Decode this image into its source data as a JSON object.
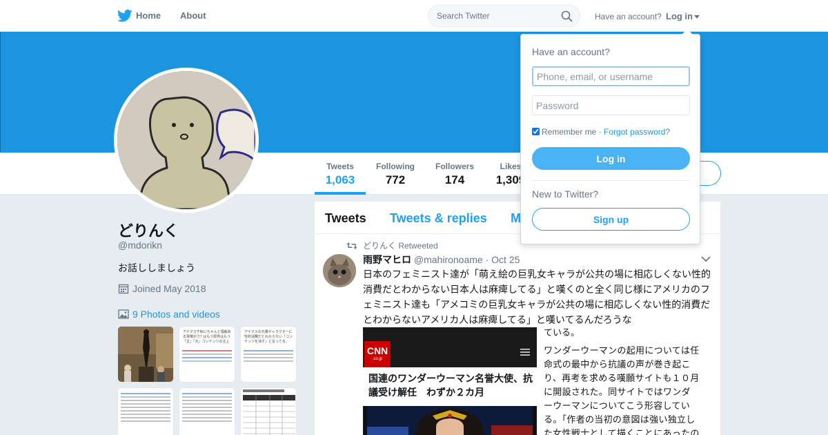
{
  "nav": {
    "home_label": "Home",
    "about_label": "About",
    "search_placeholder": "Search Twitter",
    "have_account": "Have an account?",
    "login_label": "Log in"
  },
  "colors": {
    "banner": "#1b95e0",
    "accent": "#1da1f2",
    "link": "#1b95e0"
  },
  "stats": [
    {
      "label": "Tweets",
      "value": "1,063",
      "active": true
    },
    {
      "label": "Following",
      "value": "772"
    },
    {
      "label": "Followers",
      "value": "174"
    },
    {
      "label": "Likes",
      "value": "1,309"
    }
  ],
  "profile": {
    "name": "どりんく",
    "handle": "@mdorikn",
    "bio": "お話ししましょう",
    "joined": "Joined May 2018",
    "photos_link": "9 Photos and videos"
  },
  "thumbnails": {
    "t2_text": "アイマス千秋にちゃんと理解ある現場がさ? はもう限界はもう「主」「元」コンテンツの主上",
    "t3_text": "アイマスの元量ギャラクターに性的消費だとわからない「コンテンツを消す」と言ってる。"
  },
  "timeline": {
    "tabs": [
      "Tweets",
      "Tweets & replies",
      "M"
    ],
    "retweet_line": "どりんく Retweeted",
    "tweet": {
      "fullname": "雨野マヒロ",
      "username": "@mahironoame",
      "date": "Oct 25",
      "text": "日本のフェミニスト達が「萌え絵の巨乳女キャラが公共の場に相応しくない性的消費だとわからない日本人は麻痺してる」と嘆くのと全く同じ様にアメリカのフェミニスト達も「アメコミの巨乳女キャラが公共の場に相応しくない性的消費だとわからないアメリカ人は麻痺してる」と嘆いてるんだろうな",
      "image": {
        "logo": "CNN",
        "logo_sub": ".co.jp",
        "headline": "国連のワンダーウーマン名誉大使、抗議受け解任　わずか２カ月"
      },
      "side_text_1": "ている。",
      "side_text_2": "ワンダーウーマンの起用については任命式の最中から抗議の声が巻き起こり、再考を求める嘆願サイトも１０月に開設された。同サイトではワンダーウーマンについてこう形容している。「作者の当初の意図は強い独立した女性戦士として描くことにあったのかも"
    }
  },
  "login_dropdown": {
    "title": "Have an account?",
    "username_placeholder": "Phone, email, or username",
    "password_placeholder": "Password",
    "remember_label": "Remember me",
    "separator": "·",
    "forgot_label": "Forgot password?",
    "login_button": "Log in",
    "new_prompt": "New to Twitter?",
    "signup_button": "Sign up",
    "remember_checked": true
  }
}
